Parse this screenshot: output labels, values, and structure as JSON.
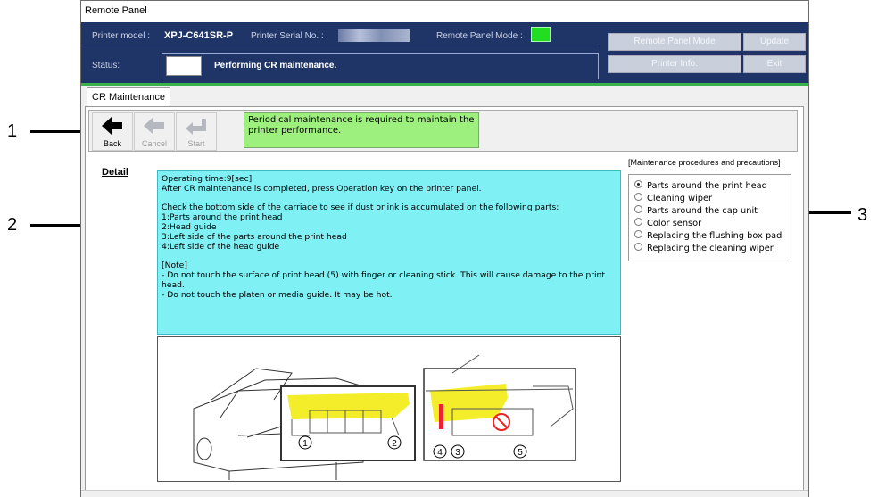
{
  "window": {
    "title": "Remote Panel"
  },
  "header": {
    "model_label": "Printer model :",
    "model_value": "XPJ-C641SR-P",
    "serial_label": "Printer Serial No. :",
    "mode_label": "Remote Panel Mode :",
    "status_label": "Status:",
    "status_value": "Performing CR maintenance.",
    "buttons": {
      "remote_panel_mode": "Remote Panel Mode",
      "update": "Update",
      "printer_info": "Printer Info.",
      "exit": "Exit"
    },
    "colors": {
      "header_bg": "#1f3568",
      "mode_indicator": "#22dd22"
    }
  },
  "tab": {
    "label": "CR Maintenance"
  },
  "toolbar": {
    "back_label": "Back",
    "cancel_label": "Cancel",
    "start_label": "Start",
    "message": "Periodical maintenance is required to maintain the printer performance."
  },
  "detail": {
    "label": "Detail",
    "text": "Operating time:9[sec]\nAfter CR maintenance is completed, press Operation key on the printer panel.\n\nCheck the bottom side of the carriage to see if dust or ink is accumulated on the following parts:\n1:Parts around the print head\n2:Head guide\n3:Left side of the parts around the print head\n4:Left side of the head guide\n\n[Note]\n- Do not touch the surface of print head (5) with finger or cleaning stick. This will cause damage to the print head.\n- Do not touch the platen or media guide. It may be hot."
  },
  "illustration": {
    "markers": [
      "1",
      "2",
      "4",
      "3",
      "5"
    ]
  },
  "procedures": {
    "title": "[Maintenance procedures and precautions]",
    "items": [
      {
        "label": "Parts around the print head",
        "selected": true
      },
      {
        "label": "Cleaning wiper",
        "selected": false
      },
      {
        "label": "Parts around the cap unit",
        "selected": false
      },
      {
        "label": "Color sensor",
        "selected": false
      },
      {
        "label": "Replacing the flushing box pad",
        "selected": false
      },
      {
        "label": "Replacing the cleaning wiper",
        "selected": false
      }
    ]
  },
  "callouts": [
    "1",
    "2",
    "3"
  ]
}
